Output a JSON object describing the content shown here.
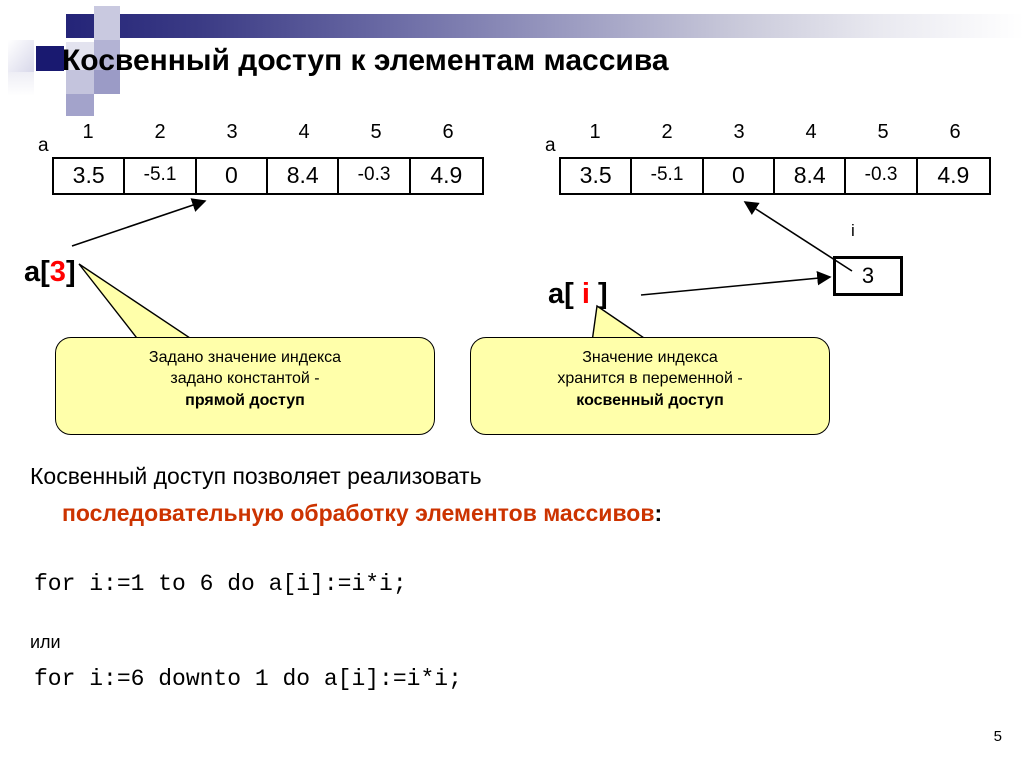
{
  "slide": {
    "title": "Косвенный доступ к элементам массива",
    "page_number": "5",
    "accent_color": "#cc3300",
    "highlight_color": "#ff0000",
    "callout_fill": "#ffffaa",
    "header_gradient_from": "#242478",
    "header_gradient_to": "#ffffff"
  },
  "arrays": {
    "indices": [
      "1",
      "2",
      "3",
      "4",
      "5",
      "6"
    ],
    "left": {
      "name": "a",
      "values": [
        "3.5",
        "-5.1",
        "0",
        "8.4",
        "-0.3",
        "4.9"
      ]
    },
    "right": {
      "name": "a",
      "values": [
        "3.5",
        "-5.1",
        "0",
        "8.4",
        "-0.3",
        "4.9"
      ]
    }
  },
  "direct": {
    "expr_prefix": "a[",
    "expr_index": "3",
    "expr_suffix": "]",
    "callout": {
      "line1": "Задано значение индекса",
      "line2": "задано константой -",
      "line3": "прямой доступ"
    }
  },
  "indirect": {
    "expr_prefix": "a[ ",
    "expr_index": "i",
    "expr_suffix": " ]",
    "variable_label": "i",
    "variable_value": "3",
    "callout": {
      "line1": "Значение индекса",
      "line2": "хранится в переменной -",
      "line3": "косвенный доступ"
    }
  },
  "body": {
    "line1": "Косвенный доступ позволяет реализовать",
    "line2_accent": "последовательную обработку элементов массивов",
    "line2_tail": ":",
    "code1": "for i:=1 to 6 do a[i]:=i*i;",
    "or_word": "или",
    "code2": "for i:=6 downto 1 do a[i]:=i*i;"
  }
}
